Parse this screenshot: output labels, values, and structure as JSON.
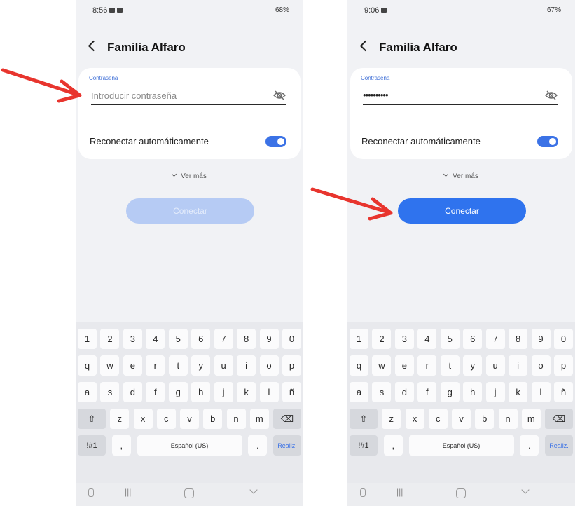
{
  "accent_color": "#2f73ee",
  "arrow_color": "#e8352e",
  "left": {
    "status": {
      "time": "8:56",
      "right": "68%"
    },
    "title": "Familia Alfaro",
    "password": {
      "label": "Contraseña",
      "placeholder": "Introducir contraseña",
      "value": ""
    },
    "reconnect_label": "Reconectar automáticamente",
    "reconnect_on": true,
    "more_label": "Ver más",
    "connect_label": "Conectar",
    "connect_enabled": false
  },
  "right": {
    "status": {
      "time": "9:06",
      "right": "67%"
    },
    "title": "Familia Alfaro",
    "password": {
      "label": "Contraseña",
      "placeholder": "",
      "value": "••••••••••"
    },
    "reconnect_label": "Reconectar automáticamente",
    "reconnect_on": true,
    "more_label": "Ver más",
    "connect_label": "Conectar",
    "connect_enabled": true
  },
  "keyboard": {
    "row1": [
      "1",
      "2",
      "3",
      "4",
      "5",
      "6",
      "7",
      "8",
      "9",
      "0"
    ],
    "row2": [
      "q",
      "w",
      "e",
      "r",
      "t",
      "y",
      "u",
      "i",
      "o",
      "p"
    ],
    "row3": [
      "a",
      "s",
      "d",
      "f",
      "g",
      "h",
      "j",
      "k",
      "l",
      "ñ"
    ],
    "row4": [
      "z",
      "x",
      "c",
      "v",
      "b",
      "n",
      "m"
    ],
    "symbols_label": "!#1",
    "comma_label": ",",
    "space_label": "Español (US)",
    "period_label": ".",
    "done_label": "Realiz."
  }
}
